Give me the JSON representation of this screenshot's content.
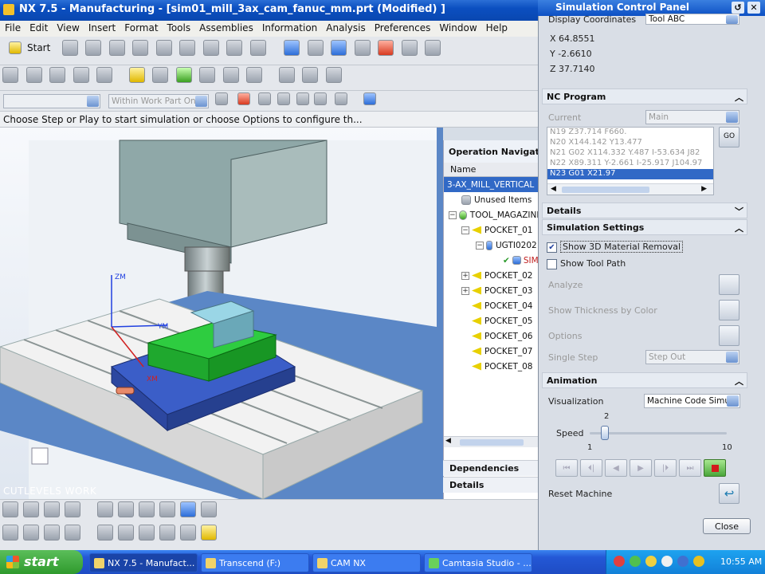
{
  "app": {
    "title": "NX 7.5 - Manufacturing - [sim01_mill_3ax_cam_fanuc_mm.prt (Modified) ]"
  },
  "menu": [
    "File",
    "Edit",
    "View",
    "Insert",
    "Format",
    "Tools",
    "Assemblies",
    "Information",
    "Analysis",
    "Preferences",
    "Window",
    "Help"
  ],
  "toolbar": {
    "start_label": "Start",
    "filter_value": "",
    "scope_value": "Within Work Part Only"
  },
  "status_line": "Choose Step or Play to start simulation or choose Options to configure th...",
  "viewport": {
    "overlay_label": "CUTLEVELS WORK",
    "axis_labels": {
      "zm": "ZM",
      "ym": "YM",
      "xm": "XM"
    }
  },
  "op_nav": {
    "title": "Operation Navigator",
    "column": "Name",
    "rows": [
      {
        "label": "3-AX_MILL_VERTICAL",
        "selected": true
      },
      {
        "label": "Unused Items"
      },
      {
        "label": "TOOL_MAGAZINE"
      },
      {
        "label": "POCKET_01"
      },
      {
        "label": "UGTI0202"
      },
      {
        "label": "SIM"
      },
      {
        "label": "POCKET_02"
      },
      {
        "label": "POCKET_03"
      },
      {
        "label": "POCKET_04"
      },
      {
        "label": "POCKET_05"
      },
      {
        "label": "POCKET_06"
      },
      {
        "label": "POCKET_07"
      },
      {
        "label": "POCKET_08"
      }
    ],
    "dependencies": "Dependencies",
    "details": "Details"
  },
  "sim_panel": {
    "title": "Simulation Control Panel",
    "display_coordinates_label": "Display Coordinates",
    "display_coordinates_value": "Tool ABC",
    "coords": {
      "x": "X 64.8551",
      "y": "Y -2.6610",
      "z": "Z 37.7140"
    },
    "nc_program": {
      "title": "NC Program",
      "current_label": "Current",
      "current_value": "Main",
      "go_button": "GO",
      "lines": [
        {
          "text": "N19 Z37.714 F660."
        },
        {
          "text": "N20 X144.142 Y13.477"
        },
        {
          "text": "N21 G02 X114.332 Y.487 I-53.634 J82"
        },
        {
          "text": "N22 X89.311 Y-2.661 I-25.917 J104.97"
        },
        {
          "text": "N23 G01 X21.97",
          "selected": true
        }
      ]
    },
    "details_title": "Details",
    "sim_settings": {
      "title": "Simulation Settings",
      "show_3d_material_removal": "Show 3D Material Removal",
      "show_tool_path": "Show Tool Path",
      "analyze": "Analyze",
      "show_thickness_by_color": "Show Thickness by Color",
      "options": "Options",
      "single_step": "Single Step",
      "single_step_value": "Step Out"
    },
    "animation": {
      "title": "Animation",
      "visualization_label": "Visualization",
      "visualization_value": "Machine Code Simu",
      "speed_label": "Speed",
      "speed_value": "2",
      "speed_min": "1",
      "speed_max": "10",
      "speed_level": 0.11,
      "reset_machine": "Reset Machine"
    },
    "close_button": "Close"
  },
  "taskbar": {
    "start": "start",
    "tasks": [
      {
        "label": "NX 7.5 - Manufact...",
        "active": true
      },
      {
        "label": "Transcend (F:)"
      },
      {
        "label": "CAM NX"
      },
      {
        "label": "Camtasia Studio - ..."
      }
    ],
    "clock": "10:55 AM"
  },
  "colors": {
    "title_blue": "#0b4fc0",
    "selection_blue": "#3169c6",
    "workpiece_green": "#2ecc40",
    "vise_blue": "#3b5ec8",
    "machine_grey": "#9fb3b2"
  }
}
